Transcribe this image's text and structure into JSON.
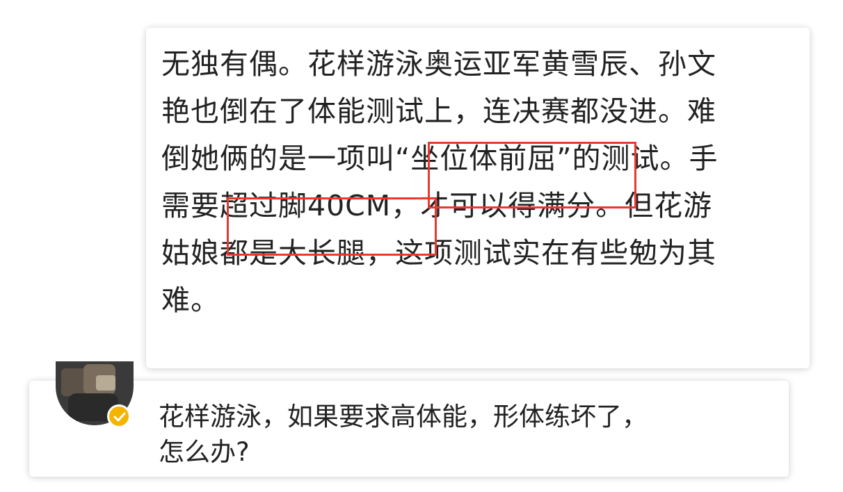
{
  "post": {
    "lines": [
      "无独有偶。花样游泳奥运亚军黄雪辰、孙文",
      "艳也倒在了体能测试上，连决赛都没进。难",
      "倒她俩的是一项叫“坐位体前屈”的测试。手",
      "需要超过脚40CM，才可以得满分。但花游",
      "姑娘都是大长腿，这项测试实在有些勉为其",
      "难。"
    ]
  },
  "comment": {
    "lines": [
      "花样游泳，如果要求高体能，形体练坏了，",
      "怎么办?"
    ],
    "verified_icon": "verified-badge-icon",
    "badge_color": "#f4b400"
  },
  "highlight_color": "#e8382f"
}
